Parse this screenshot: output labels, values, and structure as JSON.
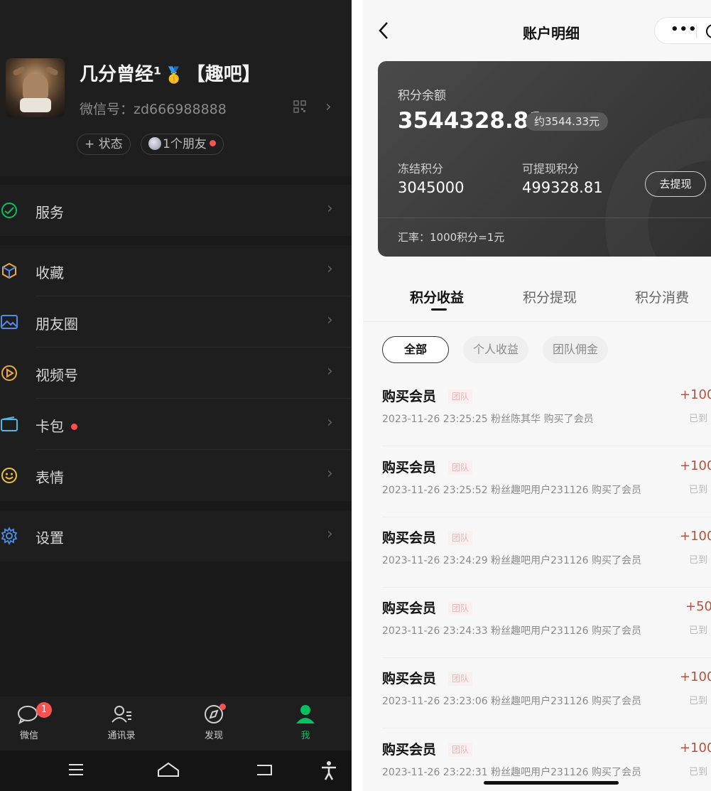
{
  "left": {
    "profile": {
      "nickname_a": "几分曾经¹",
      "medal_icon": "🥇",
      "nickname_b": "【趣吧】",
      "wechat_id": "微信号：zd666988888",
      "status_button": "+ 状态",
      "friends_button": "1个朋友"
    },
    "menu": [
      {
        "label": "服务",
        "icon": "service-icon"
      },
      {
        "label": "收藏",
        "icon": "favorites-icon"
      },
      {
        "label": "朋友圈",
        "icon": "moments-icon"
      },
      {
        "label": "视频号",
        "icon": "channels-icon"
      },
      {
        "label": "卡包",
        "icon": "cards-icon",
        "dot": true
      },
      {
        "label": "表情",
        "icon": "sticker-icon"
      },
      {
        "label": "设置",
        "icon": "settings-icon"
      }
    ],
    "tabbar": [
      {
        "label": "微信",
        "badge": "1"
      },
      {
        "label": "通讯录"
      },
      {
        "label": "发现"
      },
      {
        "label": "我"
      }
    ]
  },
  "right": {
    "title": "账户明细",
    "card": {
      "balance_label": "积分余额",
      "balance_value": "3544328.81",
      "approx": "约3544.33元",
      "frozen_label": "冻结积分",
      "frozen_value": "3045000",
      "withdrawable_label": "可提现积分",
      "withdrawable_value": "499328.81",
      "withdraw_button": "去提现",
      "rate": "汇率：1000积分=1元"
    },
    "tabs": [
      "积分收益",
      "积分提现",
      "积分消费"
    ],
    "filters": [
      "全部",
      "个人收益",
      "团队佣金"
    ],
    "records": [
      {
        "title": "购买会员",
        "tag": "团队",
        "detail": "2023-11-26 23:25:25 粉丝陈其华 购买了会员",
        "amount": "+100",
        "status": "已到"
      },
      {
        "title": "购买会员",
        "tag": "团队",
        "detail": "2023-11-26 23:25:52 粉丝趣吧用户231126 购买了会员",
        "amount": "+100",
        "status": "已到"
      },
      {
        "title": "购买会员",
        "tag": "团队",
        "detail": "2023-11-26 23:24:29 粉丝趣吧用户231126 购买了会员",
        "amount": "+100",
        "status": "已到"
      },
      {
        "title": "购买会员",
        "tag": "团队",
        "detail": "2023-11-26 23:24:33 粉丝趣吧用户231126 购买了会员",
        "amount": "+50",
        "status": "已到"
      },
      {
        "title": "购买会员",
        "tag": "团队",
        "detail": "2023-11-26 23:23:06 粉丝趣吧用户231126 购买了会员",
        "amount": "+100",
        "status": "已到"
      },
      {
        "title": "购买会员",
        "tag": "团队",
        "detail": "2023-11-26 23:22:31 粉丝趣吧用户231126 购买了会员",
        "amount": "+100",
        "status": "已到"
      }
    ]
  },
  "colors": {
    "wechat_green": "#07c160",
    "badge_red": "#fa5151",
    "amount_red": "#b5533f"
  }
}
